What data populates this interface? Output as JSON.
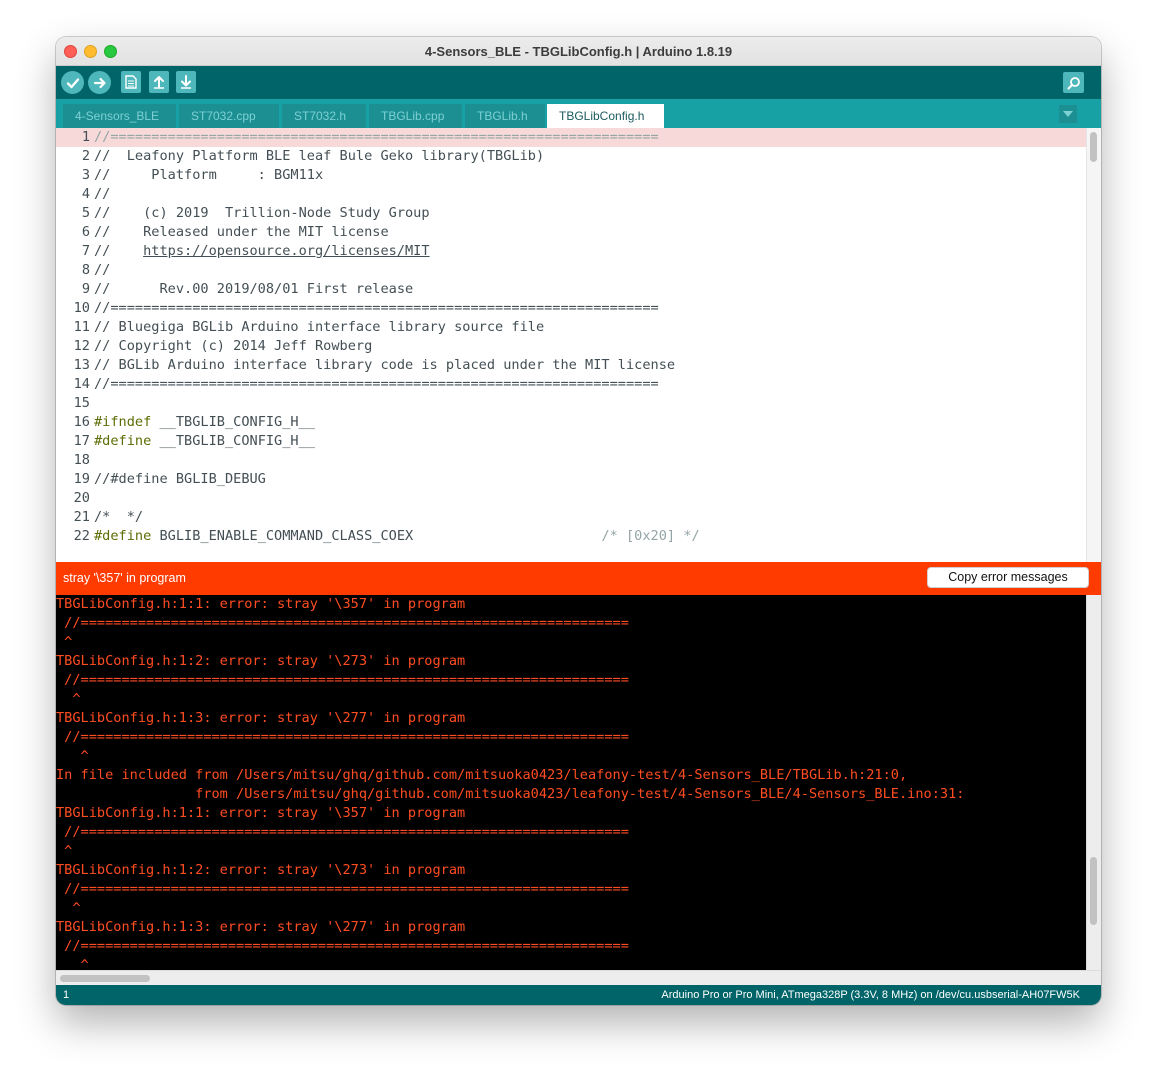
{
  "window": {
    "title": "4-Sensors_BLE - TBGLibConfig.h | Arduino 1.8.19"
  },
  "toolbar": {
    "buttons": [
      {
        "name": "verify",
        "icon": "checkmark-icon"
      },
      {
        "name": "upload",
        "icon": "arrow-right-icon"
      },
      {
        "name": "new",
        "icon": "new-file-icon"
      },
      {
        "name": "open",
        "icon": "arrow-up-icon"
      },
      {
        "name": "save",
        "icon": "arrow-down-icon"
      }
    ],
    "serial_monitor_icon": "magnifier-icon"
  },
  "tabs": [
    {
      "label": "4-Sensors_BLE",
      "active": false
    },
    {
      "label": "ST7032.cpp",
      "active": false
    },
    {
      "label": "ST7032.h",
      "active": false
    },
    {
      "label": "TBGLib.cpp",
      "active": false
    },
    {
      "label": "TBGLib.h",
      "active": false
    },
    {
      "label": "TBGLibConfig.h",
      "active": true
    }
  ],
  "editor": {
    "lines": [
      {
        "n": "1",
        "parts": [
          {
            "t": "//===================================================================",
            "c": "cmt"
          }
        ]
      },
      {
        "n": "2",
        "parts": [
          {
            "t": "//  Leafony Platform BLE leaf Bule Geko library(TBGLib)",
            "c": ""
          }
        ]
      },
      {
        "n": "3",
        "parts": [
          {
            "t": "//     Platform     : BGM11x",
            "c": ""
          }
        ]
      },
      {
        "n": "4",
        "parts": [
          {
            "t": "//",
            "c": ""
          }
        ]
      },
      {
        "n": "5",
        "parts": [
          {
            "t": "//    (c) 2019  Trillion-Node Study Group",
            "c": ""
          }
        ]
      },
      {
        "n": "6",
        "parts": [
          {
            "t": "//    Released under the MIT license",
            "c": ""
          }
        ]
      },
      {
        "n": "7",
        "parts": [
          {
            "t": "//    ",
            "c": ""
          },
          {
            "t": "https://opensource.org/licenses/MIT",
            "c": "link"
          }
        ]
      },
      {
        "n": "8",
        "parts": [
          {
            "t": "//",
            "c": ""
          }
        ]
      },
      {
        "n": "9",
        "parts": [
          {
            "t": "//      Rev.00 2019/08/01 First release",
            "c": ""
          }
        ]
      },
      {
        "n": "10",
        "parts": [
          {
            "t": "//===================================================================",
            "c": ""
          }
        ]
      },
      {
        "n": "11",
        "parts": [
          {
            "t": "// Bluegiga BGLib Arduino interface library source file",
            "c": ""
          }
        ]
      },
      {
        "n": "12",
        "parts": [
          {
            "t": "// Copyright (c) 2014 Jeff Rowberg",
            "c": ""
          }
        ]
      },
      {
        "n": "13",
        "parts": [
          {
            "t": "// BGLib Arduino interface library code is placed under the MIT license",
            "c": ""
          }
        ]
      },
      {
        "n": "14",
        "parts": [
          {
            "t": "//===================================================================",
            "c": ""
          }
        ]
      },
      {
        "n": "15",
        "parts": [
          {
            "t": "",
            "c": ""
          }
        ]
      },
      {
        "n": "16",
        "parts": [
          {
            "t": "#ifndef",
            "c": "kw"
          },
          {
            "t": " __TBGLIB_CONFIG_H__",
            "c": ""
          }
        ]
      },
      {
        "n": "17",
        "parts": [
          {
            "t": "#define",
            "c": "kw"
          },
          {
            "t": " __TBGLIB_CONFIG_H__",
            "c": ""
          }
        ]
      },
      {
        "n": "18",
        "parts": [
          {
            "t": "",
            "c": ""
          }
        ]
      },
      {
        "n": "19",
        "parts": [
          {
            "t": "//#define BGLIB_DEBUG",
            "c": ""
          }
        ]
      },
      {
        "n": "20",
        "parts": [
          {
            "t": "",
            "c": ""
          }
        ]
      },
      {
        "n": "21",
        "parts": [
          {
            "t": "/*  */",
            "c": ""
          }
        ]
      },
      {
        "n": "22",
        "parts": [
          {
            "t": "#define",
            "c": "kw"
          },
          {
            "t": " BGLIB_ENABLE_COMMAND_CLASS_COEX                       ",
            "c": ""
          },
          {
            "t": "/* [0x20] */",
            "c": "cmt"
          }
        ]
      }
    ]
  },
  "error_bar": {
    "message": "stray '\\357' in program",
    "copy_button_label": "Copy error messages"
  },
  "console": {
    "lines": [
      "TBGLibConfig.h:1:1: error: stray '\\357' in program",
      " //===================================================================",
      " ^",
      "TBGLibConfig.h:1:2: error: stray '\\273' in program",
      " //===================================================================",
      "  ^",
      "TBGLibConfig.h:1:3: error: stray '\\277' in program",
      " //===================================================================",
      "   ^",
      "In file included from /Users/mitsu/ghq/github.com/mitsuoka0423/leafony-test/4-Sensors_BLE/TBGLib.h:21:0,",
      "                 from /Users/mitsu/ghq/github.com/mitsuoka0423/leafony-test/4-Sensors_BLE/4-Sensors_BLE.ino:31:",
      "TBGLibConfig.h:1:1: error: stray '\\357' in program",
      " //===================================================================",
      " ^",
      "TBGLibConfig.h:1:2: error: stray '\\273' in program",
      " //===================================================================",
      "  ^",
      "TBGLibConfig.h:1:3: error: stray '\\277' in program",
      " //===================================================================",
      "   ^"
    ]
  },
  "status_bar": {
    "line_number": "1",
    "board": "Arduino Pro or Pro Mini, ATmega328P (3.3V, 8 MHz) on /dev/cu.usbserial-AH07FW5K"
  },
  "colors": {
    "toolbar": "#006468",
    "tabbar": "#17a1a5",
    "error_bar": "#ff3b00",
    "console_text": "#ff4d22",
    "keyword": "#5e6d03",
    "highlight_line": "#f7d9da"
  }
}
